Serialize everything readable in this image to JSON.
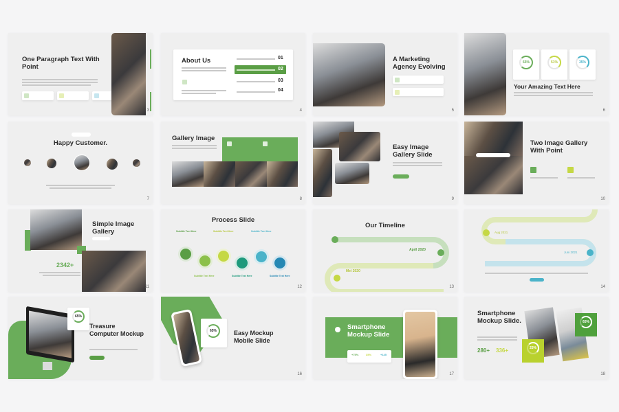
{
  "colors": {
    "green": "#6aad5a",
    "lime": "#c5d845",
    "teal": "#4ab3c9",
    "bg": "#f5f5f6"
  },
  "slides": [
    {
      "number": "3",
      "title": "One Paragraph Text With Point"
    },
    {
      "number": "4",
      "title": "About Us",
      "items": [
        "01",
        "02",
        "03",
        "04"
      ],
      "active": "02"
    },
    {
      "number": "5",
      "title": "A Marketing Agency Evolving"
    },
    {
      "number": "6",
      "title": "Your Amazing Text Here",
      "stats": [
        "65%",
        "51%",
        "35%"
      ]
    },
    {
      "number": "7",
      "title": "Happy Customer."
    },
    {
      "number": "8",
      "title": "Gallery Image"
    },
    {
      "number": "9",
      "title": "Easy Image Gallery Slide"
    },
    {
      "number": "10",
      "title": "Two Image Gallery With Point"
    },
    {
      "number": "11",
      "title": "Simple Image Gallery",
      "stat": "2342+"
    },
    {
      "number": "12",
      "title": "Process Slide",
      "subtitle": "Subtitle Text Here"
    },
    {
      "number": "13",
      "title": "Our Timeline",
      "dates": [
        "April 2020",
        "Mei 2020"
      ]
    },
    {
      "number": "14",
      "dates": [
        "Aug 2021",
        "Juni 2021"
      ]
    },
    {
      "title": "Treasure Computer Mockup",
      "stat": "65%"
    },
    {
      "number": "16",
      "title": "Easy Mockup Mobile Slide",
      "stat": "65%"
    },
    {
      "number": "17",
      "title": "Smartphone Mockup Slide",
      "stats": [
        "+75%",
        "35%",
        "+145"
      ]
    },
    {
      "number": "18",
      "title": "Smartphone Mockup Slide.",
      "stats": [
        "280+",
        "336+"
      ],
      "rings": [
        "65%",
        "25%"
      ]
    }
  ]
}
